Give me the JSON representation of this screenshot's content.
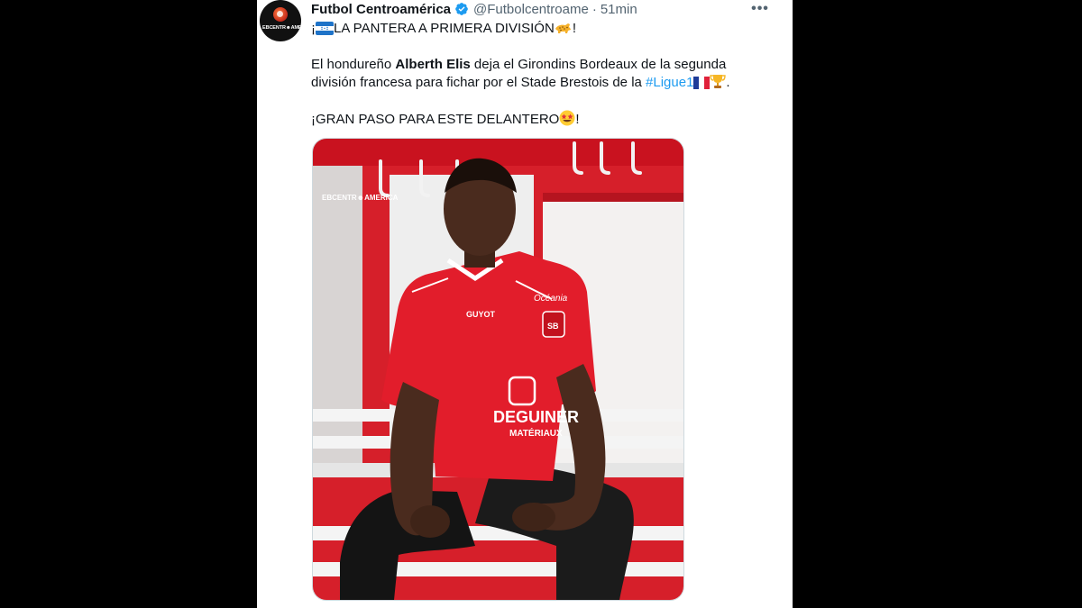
{
  "tweet": {
    "author_name": "Futbol Centroamérica",
    "author_handle": "@Futbolcentroame",
    "separator": "·",
    "time": "51min",
    "avatar_text": "EBCENTR☻AMERICA",
    "more_label": "•••",
    "line1": {
      "pre": "¡",
      "text": "LA PANTERA A PRIMERA DIVISIÓN",
      "post": "!"
    },
    "line2": {
      "pre": "El hondureño ",
      "bold": "Alberth Elis",
      "post": " deja el Girondins Bordeaux de la segunda"
    },
    "line3": {
      "pre": "división francesa para fichar por el Stade Brestois de la ",
      "hashtag": "#Ligue1",
      "post": "."
    },
    "line4": {
      "text": "¡GRAN PASO PARA ESTE DELANTERO",
      "post": "!"
    },
    "icons": {
      "verified": "verified-badge-icon",
      "flag_honduras": "honduras-flag-icon",
      "leopard": "leopard-emoji-icon",
      "flag_france": "france-flag-icon",
      "trophy": "trophy-emoji-icon",
      "star_eyes": "star-struck-emoji-icon",
      "more": "more-options-icon"
    },
    "colors": {
      "link": "#1d9bf0",
      "verified": "#1d9bf0",
      "jersey_red": "#e21d2b"
    },
    "media": {
      "watermark": "EBCENTR☻AMERICA",
      "sponsor_top": "GUYOT",
      "sponsor_right": "Océania",
      "sponsor_main": "DEGUINER",
      "sponsor_sub": "MATÉRIAUX",
      "club_badge": "SB"
    }
  }
}
